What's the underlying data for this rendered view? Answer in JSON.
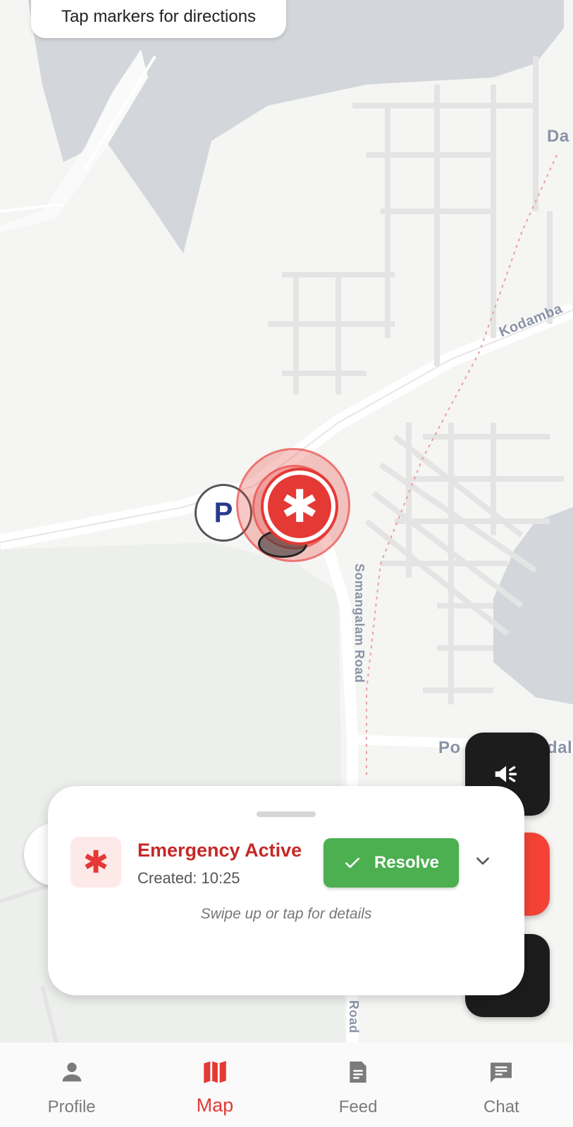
{
  "map": {
    "hint": "Tap markers for directions",
    "labels": {
      "da": "Da",
      "kodamba": "Kodamba",
      "somangalam_road": "Somangalam Road",
      "po": "Po",
      "dal": "dal",
      "road": "Road"
    },
    "markers": {
      "parking": "P",
      "emergency": "✱"
    },
    "colors": {
      "water": "#d3d6da",
      "park": "#e8ebe8",
      "road": "#ffffff",
      "accent": "#e53935"
    }
  },
  "sheet": {
    "title": "Emergency Active",
    "created": "Created: 10:25",
    "resolve_label": "Resolve",
    "swipe_hint": "Swipe up or tap for details",
    "icon": "asterisk-icon"
  },
  "nav": {
    "items": [
      {
        "label": "Profile",
        "icon": "person-icon"
      },
      {
        "label": "Map",
        "icon": "map-icon"
      },
      {
        "label": "Feed",
        "icon": "document-icon"
      },
      {
        "label": "Chat",
        "icon": "chat-icon"
      }
    ],
    "active": "Map"
  }
}
